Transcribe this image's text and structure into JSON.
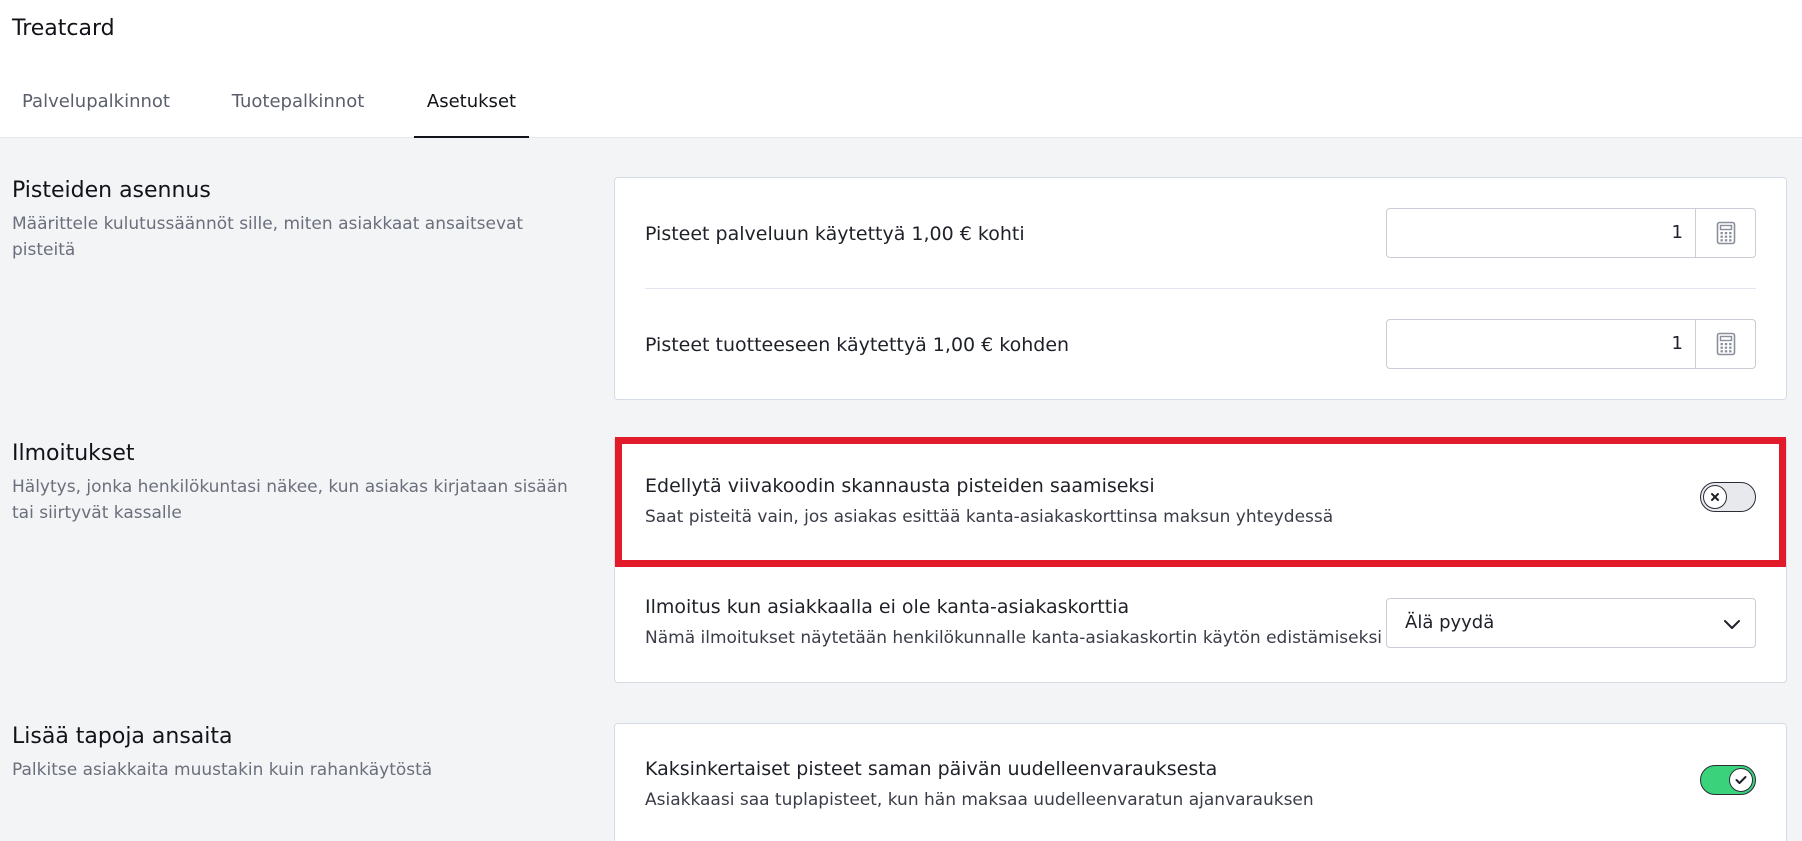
{
  "app": {
    "title": "Treatcard"
  },
  "tabs": [
    {
      "label": "Palvelupalkinnot"
    },
    {
      "label": "Tuotepalkinnot"
    },
    {
      "label": "Asetukset"
    }
  ],
  "sections": {
    "points": {
      "title": "Pisteiden asennus",
      "description": "Määrittele kulutussäännöt sille, miten asiakkaat ansaitsevat pisteitä",
      "service_label": "Pisteet palveluun käytettyä 1,00 € kohti",
      "service_value": "1",
      "product_label": "Pisteet tuotteeseen käytettyä 1,00 € kohden",
      "product_value": "1"
    },
    "notifications": {
      "title": "Ilmoitukset",
      "description": "Hälytys, jonka henkilökuntasi näkee, kun asiakas kirjataan sisään tai siirtyvät kassalle",
      "scan_title": "Edellytä viivakoodin skannausta pisteiden saamiseksi",
      "scan_desc": "Saat pisteitä vain, jos asiakas esittää kanta-asiakaskorttinsa maksun yhteydessä",
      "scan_enabled": false,
      "nocard_title": "Ilmoitus kun asiakkaalla ei ole kanta-asiakaskorttia",
      "nocard_desc": "Nämä ilmoitukset näytetään henkilökunnalle kanta-asiakaskortin käytön edistämiseksi",
      "nocard_selected": "Älä pyydä"
    },
    "earn": {
      "title": "Lisää tapoja ansaita",
      "description": "Palkitse asiakkaita muustakin kuin rahankäytöstä",
      "double_title": "Kaksinkertaiset pisteet saman päivän uudelleenvarauksesta",
      "double_desc": "Asiakkaasi saa tuplapisteet, kun hän maksaa uudelleenvaratun ajanvarauksen",
      "double_enabled": true
    }
  },
  "colors": {
    "highlight": "#e21b2a",
    "toggle_on": "#3ad27a",
    "toggle_off": "#e8e9ed"
  }
}
